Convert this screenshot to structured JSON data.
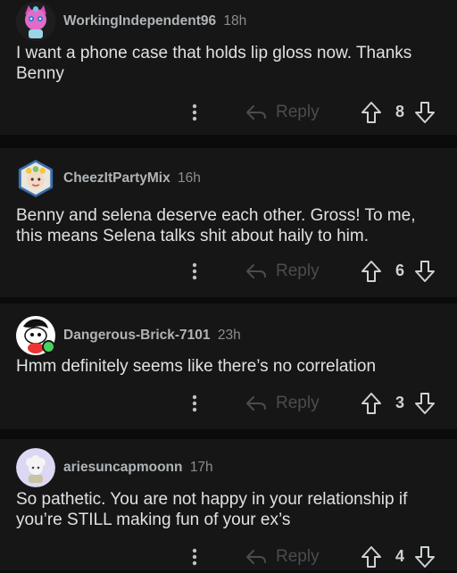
{
  "comments": [
    {
      "username": "WorkingIndependent96",
      "time": "18h",
      "text": "I want a phone case that holds lip gloss now. Thanks\nBenny",
      "reply_label": "Reply",
      "score": "8",
      "avatar_icon": "pink-cat-avatar-icon"
    },
    {
      "username": "CheezItPartyMix",
      "time": "16h",
      "text": "Benny and selena deserve each other. Gross! To me,\nthis means Selena talks shit about haily to him.",
      "reply_label": "Reply",
      "score": "6",
      "avatar_icon": "flower-crown-avatar-icon"
    },
    {
      "username": "Dangerous-Brick-7101",
      "time": "23h",
      "text": "Hmm definitely seems like there’s no correlation",
      "reply_label": "Reply",
      "score": "3",
      "avatar_icon": "snoo-avatar-icon"
    },
    {
      "username": "ariesuncapmoonn",
      "time": "17h",
      "text": "So pathetic. You are not happy in your relationship if\nyou’re STILL making fun of your ex’s",
      "reply_label": "Reply",
      "score": "4",
      "avatar_icon": "sheep-avatar-icon"
    }
  ],
  "colors": {
    "background": "#0b0b0b",
    "card": "#161616",
    "username": "#b0b4b7",
    "online": "#46d160"
  }
}
